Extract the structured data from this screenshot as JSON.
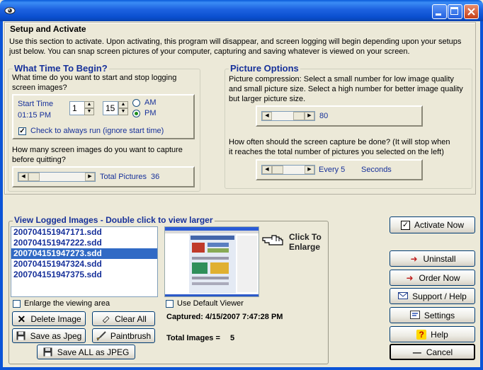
{
  "window": {
    "icon": "eye-icon",
    "buttons": [
      "minimize-icon",
      "maximize-icon",
      "close-icon"
    ]
  },
  "setup": {
    "title": "Setup and Activate",
    "description_1": "Use this section to activate. Upon activating, this program will disappear, and screen logging will begin depending upon your setups",
    "description_2": "just below. You can snap screen pictures of your computer, capturing and saving whatever is viewed on your screen."
  },
  "time": {
    "title": "What Time To Begin?",
    "question_1": "What time do you want to start and stop logging",
    "question_2": "screen images?",
    "start_label": "Start Time",
    "start_value": "01:15 PM",
    "hour": "1",
    "minute": "15",
    "am": "AM",
    "pm": "PM",
    "selected_period": "PM",
    "always_run_label": "Check to always run (ignore start time)",
    "always_run_checked": true,
    "capture_q_1": "How many screen images do you want to capture",
    "capture_q_2": "before quitting?",
    "total_label": "Total Pictures",
    "total_value": "36",
    "total_slider_level": 0.05
  },
  "picture": {
    "title": "Picture Options",
    "desc_1": "Picture compression: Select a small number for low image quality",
    "desc_2": "and small picture size. Select a high number for better image quality",
    "desc_3": "but larger picture size.",
    "compression_value": "80",
    "compression_level": 0.8,
    "freq_1": "How often should the screen capture be done? (It will stop when",
    "freq_2": "it reaches the total number of pictures you selected on the left)",
    "every_label": "Every 5",
    "seconds_label": "Seconds",
    "freq_level": 0.05
  },
  "logged": {
    "title": "View Logged Images - Double click to view larger",
    "files": [
      "200704151947171.sdd",
      "200704151947222.sdd",
      "200704151947273.sdd",
      "200704151947324.sdd",
      "200704151947375.sdd"
    ],
    "selected_index": 2,
    "click_to": "Click To",
    "enlarge": "Enlarge",
    "enlarge_area_label": "Enlarge the viewing area",
    "default_viewer_label": "Use Default Viewer",
    "captured": "Captured: 4/15/2007 7:47:28 PM",
    "total_label": "Total Images =",
    "total_value": "5",
    "delete_label": "Delete Image",
    "clear_label": "Clear All",
    "save_jpeg_label": "Save as Jpeg",
    "paintbrush_label": "Paintbrush",
    "save_all_label": "Save ALL as JPEG"
  },
  "actions": {
    "activate": "Activate Now",
    "uninstall": "Uninstall",
    "order": "Order Now",
    "support": "Support / Help",
    "settings": "Settings",
    "help": "Help",
    "cancel": "Cancel"
  }
}
